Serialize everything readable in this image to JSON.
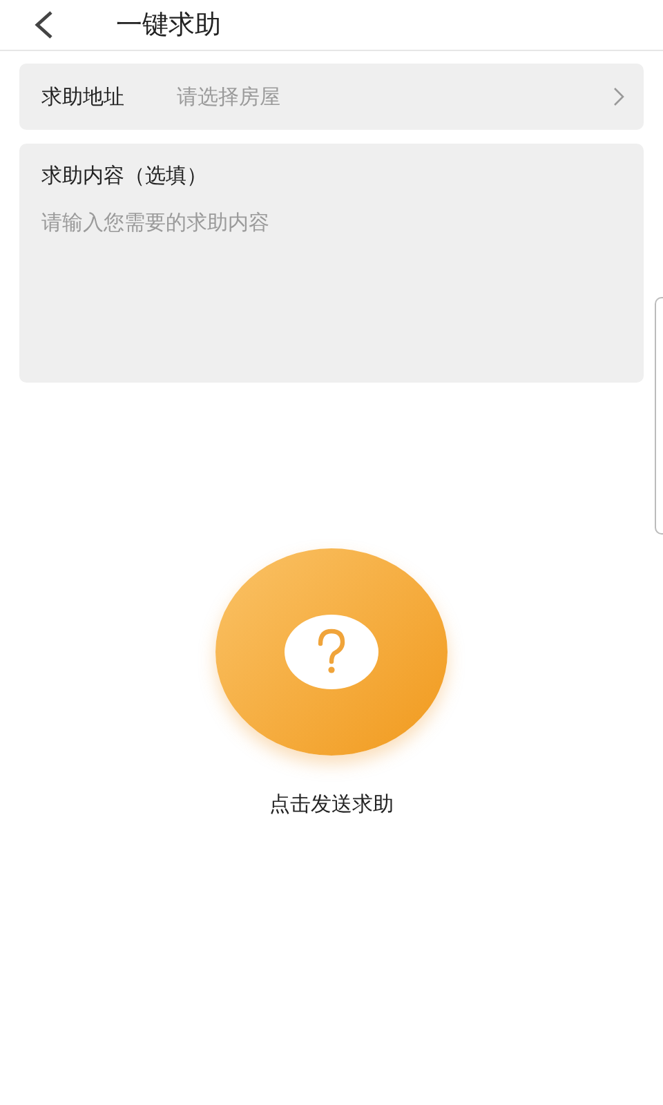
{
  "header": {
    "title": "一键求助"
  },
  "address": {
    "label": "求助地址",
    "placeholder": "请选择房屋"
  },
  "content": {
    "label": "求助内容（选填）",
    "placeholder": "请输入您需要的求助内容"
  },
  "help_button": {
    "caption": "点击发送求助"
  }
}
